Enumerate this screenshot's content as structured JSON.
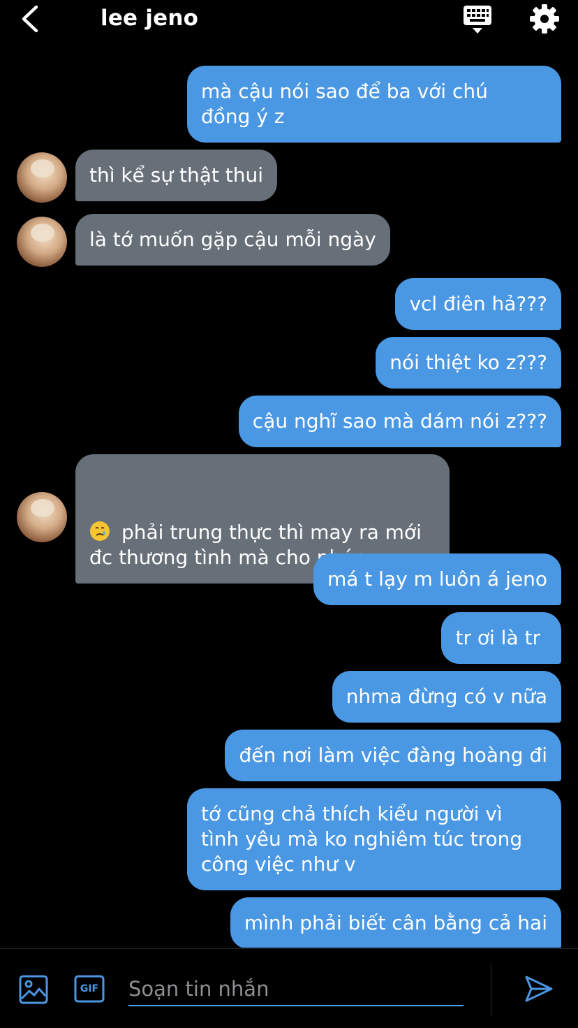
{
  "header": {
    "title": "lee jeno",
    "back_icon": "chevron-left-icon",
    "keyboard_icon": "keyboard-icon",
    "settings_icon": "gear-icon"
  },
  "messages": [
    {
      "side": "sent",
      "text": "mà cậu nói sao để ba với chú\nđồng ý z"
    },
    {
      "side": "recv",
      "text": "thì kể sự thật thui"
    },
    {
      "side": "recv",
      "text": "là tớ muốn gặp cậu mỗi ngày"
    },
    {
      "side": "sent",
      "text": "vcl điên hả???"
    },
    {
      "side": "sent",
      "text": "nói thiệt ko z???"
    },
    {
      "side": "sent",
      "text": "cậu nghĩ sao mà dám nói z???"
    },
    {
      "side": "recv",
      "emoji": "crying-face-emoji",
      "text": "phải trung thực thì may ra mới\nđc thương tình mà cho phép"
    },
    {
      "side": "sent",
      "text": "má t lạy m luôn á jeno"
    },
    {
      "side": "sent",
      "text": "tr ơi là tr"
    },
    {
      "side": "sent",
      "text": "nhma đừng có v nữa"
    },
    {
      "side": "sent",
      "text": "đến nơi làm việc đàng hoàng đi"
    },
    {
      "side": "sent",
      "text": "tớ cũng chả thích kiểu người vì\ntình yêu mà ko nghiêm túc trong\ncông việc như v"
    },
    {
      "side": "sent",
      "text": "mình phải biết cân bằng cả hai"
    }
  ],
  "composer": {
    "placeholder": "Soạn tin nhắn",
    "gif_label": "GIF",
    "image_icon": "image-icon",
    "send_icon": "send-icon"
  },
  "colors": {
    "sent_bubble": "#4a97e3",
    "received_bubble": "#676f78",
    "background": "#000000",
    "accent": "#4a97e3"
  }
}
